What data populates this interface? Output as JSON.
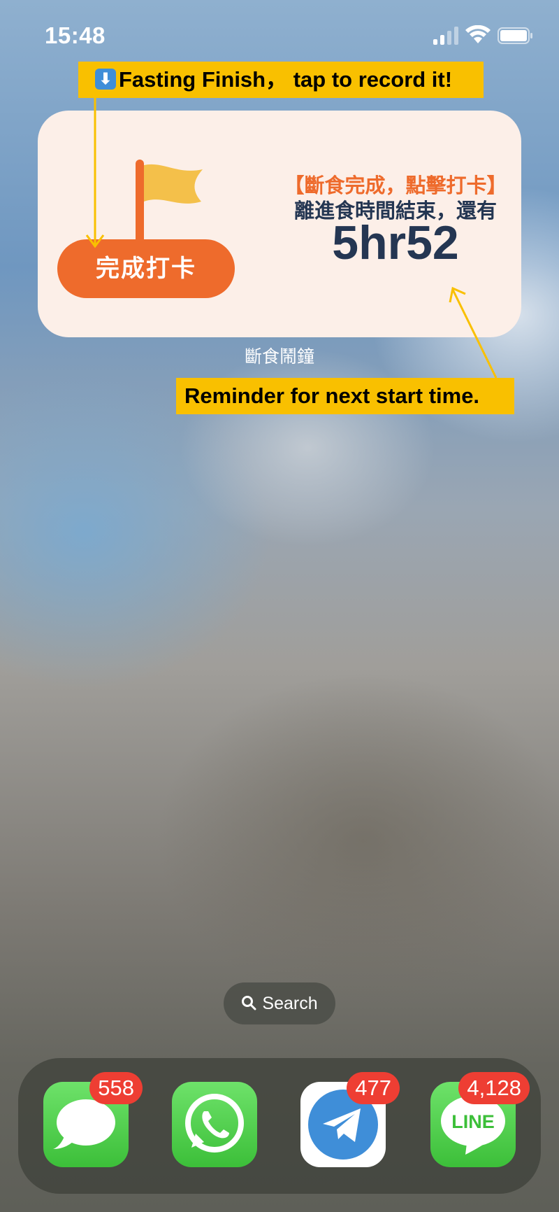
{
  "status_bar": {
    "time": "15:48",
    "signal_icon": "cellular-signal-icon",
    "wifi_icon": "wifi-icon",
    "battery_icon": "battery-icon"
  },
  "annotations": {
    "top": {
      "emoji": "⬇",
      "text": "Fasting Finish， tap to record it!"
    },
    "bottom": {
      "text": "Reminder for next start time."
    }
  },
  "widget": {
    "button_label": "完成打卡",
    "heading": "【斷食完成，點擊打卡】",
    "subtitle": "離進食時間結束，還有",
    "timer": "5hr52",
    "app_label": "斷食鬧鐘",
    "colors": {
      "accent": "#ee6b2c",
      "text": "#243652",
      "background": "#fcefe8",
      "flag": "#f4c04a"
    }
  },
  "search": {
    "label": "Search"
  },
  "dock": {
    "apps": [
      {
        "name": "Messages",
        "icon": "messages-icon",
        "badge": "558"
      },
      {
        "name": "WhatsApp",
        "icon": "whatsapp-icon",
        "badge": ""
      },
      {
        "name": "Telegram",
        "icon": "telegram-icon",
        "badge": "477"
      },
      {
        "name": "LINE",
        "icon": "line-icon",
        "badge": "4,128",
        "icon_text": "LINE"
      }
    ]
  },
  "colors": {
    "callout": "#f9c000",
    "badge": "#ee3e33"
  }
}
